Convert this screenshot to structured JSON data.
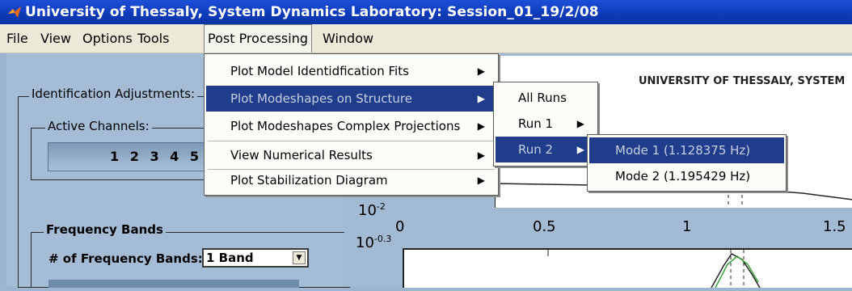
{
  "window": {
    "title": "University of Thessaly, System Dynamics Laboratory: Session_01_19/2/08"
  },
  "menubar": [
    "File",
    "View",
    "Options",
    "Tools",
    "Post Processing",
    "Window"
  ],
  "post_processing_menu": [
    "Plot Model Identidfication Fits",
    "Plot Modeshapes on Structure",
    "Plot Modeshapes Complex Projections",
    "View Numerical Results",
    "Plot Stabilization Diagram"
  ],
  "runs_submenu": [
    "All Runs",
    "Run 1",
    "Run 2"
  ],
  "modes_submenu": [
    "Mode 1 (1.128375 Hz)",
    "Mode 2 (1.195429 Hz)"
  ],
  "left_panel": {
    "identification_label": "Identification Adjustments:",
    "active_channels_label": "Active Channels:",
    "active_channels_value": "1 2 3 4 5",
    "frequency_bands_label": "Frequency Bands",
    "num_bands_label": "# of Frequency Bands:",
    "num_bands_value": "1 Band"
  },
  "plot": {
    "title": "UNIVERSITY OF THESSALY, SYSTEM",
    "y_tick_upper_base": "10",
    "y_tick_upper_exp": "-2",
    "y_tick_lower_base": "10",
    "y_tick_lower_exp": "-0.3",
    "x_ticks": [
      "0",
      "0.5",
      "1",
      "1.5"
    ]
  },
  "colors": {
    "title_bar": "#0d3ab7",
    "menu_highlight": "#1f3d8b",
    "menu_bg": "#fcfcf9"
  },
  "icons": {
    "window_icon": "matlab-icon"
  }
}
